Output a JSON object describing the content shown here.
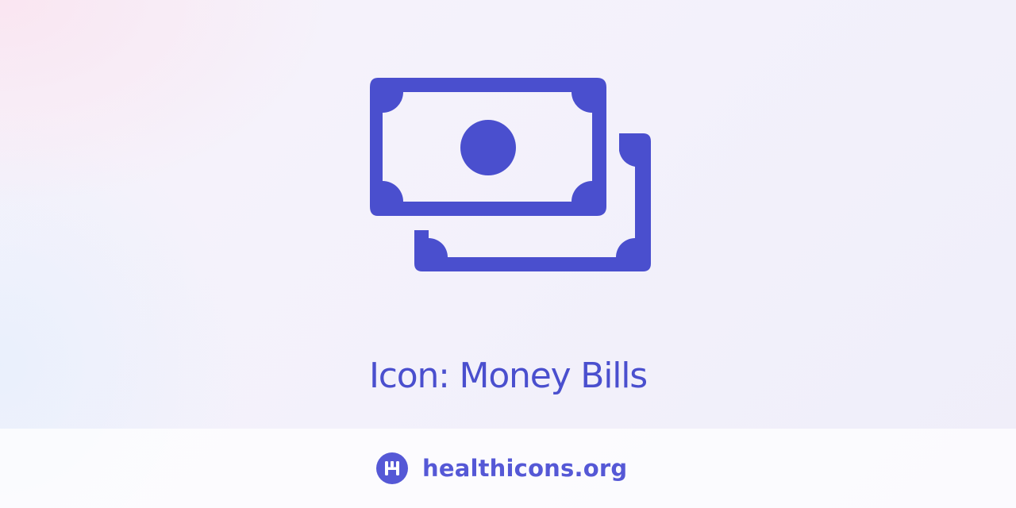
{
  "icon": {
    "name": "money-bills-icon",
    "color": "#4a4fce"
  },
  "title": "Icon: Money Bills",
  "footer": {
    "logo_icon": "healthicons-h-logo",
    "site": "healthicons.org",
    "brand_color": "#5558d6"
  }
}
